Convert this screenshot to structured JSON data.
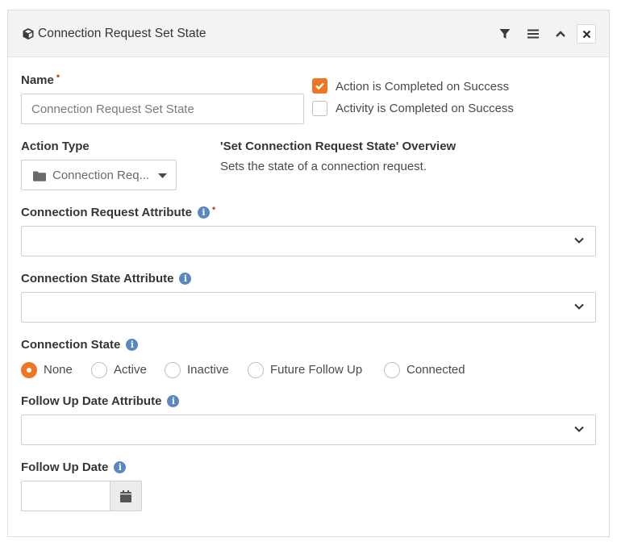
{
  "panel": {
    "title": "Connection Request Set State",
    "icons": {
      "title": "cube-icon",
      "filter": "filter-icon",
      "menu": "menu-icon",
      "collapse": "chevron-up-icon",
      "close": "close-icon"
    }
  },
  "name_field": {
    "label": "Name",
    "required_marker": "•",
    "value": "Connection Request Set State"
  },
  "checkboxes": [
    {
      "label": "Action is Completed on Success",
      "checked": true
    },
    {
      "label": "Activity is Completed on Success",
      "checked": false
    }
  ],
  "action_type": {
    "label": "Action Type",
    "selected": "Connection Req...",
    "icon": "folder-icon"
  },
  "overview": {
    "title": "'Set Connection Request State' Overview",
    "description": "Sets the state of a connection request."
  },
  "connection_request_attribute": {
    "label": "Connection Request Attribute",
    "required_marker": "•",
    "value": ""
  },
  "connection_state_attribute": {
    "label": "Connection State Attribute",
    "value": ""
  },
  "connection_state": {
    "label": "Connection State",
    "options": [
      "None",
      "Active",
      "Inactive",
      "Future Follow Up",
      "Connected"
    ],
    "selected": "None"
  },
  "follow_up_date_attribute": {
    "label": "Follow Up Date Attribute",
    "value": ""
  },
  "follow_up_date": {
    "label": "Follow Up Date",
    "value": "",
    "icon": "calendar-icon"
  },
  "info_glyph": "i",
  "colors": {
    "accent": "#ee7725",
    "info": "#5a86c4",
    "required": "#d4442a"
  }
}
